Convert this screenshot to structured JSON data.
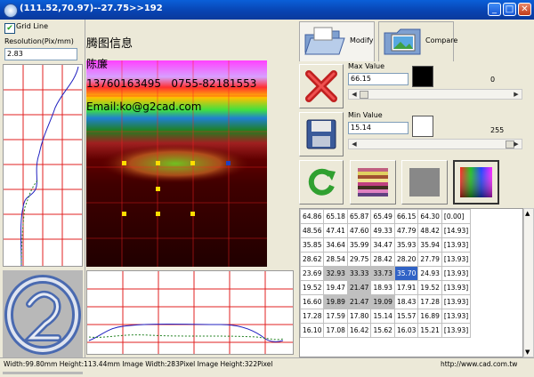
{
  "window": {
    "title": "(111.52,70.97)--27.75>>192"
  },
  "left": {
    "grid_line_label": "Grid Line",
    "grid_line_checked": true,
    "resolution_label": "Resolution(Pix/mm)",
    "resolution_value": "2.83"
  },
  "center": {
    "company": "腾图信息",
    "name": "陈廉",
    "phone": "13760163495   0755-82181553",
    "email": "Email:ko@g2cad.com"
  },
  "tabs": [
    {
      "label": "Modify"
    },
    {
      "label": "Compare"
    }
  ],
  "max": {
    "label": "Max Value",
    "value": "66.15",
    "level": "0",
    "swatch": "#000000"
  },
  "min": {
    "label": "Min Value",
    "value": "15.14",
    "level": "255",
    "swatch": "#ffffff"
  },
  "table": {
    "rows": [
      [
        "64.86",
        "65.18",
        "65.87",
        "65.49",
        "66.15",
        "64.30",
        "[0.00]"
      ],
      [
        "48.56",
        "47.41",
        "47.60",
        "49.33",
        "47.79",
        "48.42",
        "[14.93]"
      ],
      [
        "35.85",
        "34.64",
        "35.99",
        "34.47",
        "35.93",
        "35.94",
        "[13.93]"
      ],
      [
        "28.62",
        "28.54",
        "29.75",
        "28.42",
        "28.20",
        "27.79",
        "[13.93]"
      ],
      [
        "23.69",
        "32.93",
        "33.33",
        "33.73",
        "35.70",
        "24.93",
        "[13.93]"
      ],
      [
        "19.52",
        "19.47",
        "21.47",
        "18.93",
        "17.91",
        "19.52",
        "[13.93]"
      ],
      [
        "16.60",
        "19.89",
        "21.47",
        "19.09",
        "18.43",
        "17.28",
        "[13.93]"
      ],
      [
        "17.28",
        "17.59",
        "17.80",
        "15.14",
        "15.57",
        "16.89",
        "[13.93]"
      ],
      [
        "16.10",
        "17.08",
        "16.42",
        "15.62",
        "16.03",
        "15.21",
        "[13.93]"
      ]
    ]
  },
  "status": {
    "text": "Width:99.80mm  Height:113.44mm  Image Width:283Pixel  Image Height:322Pixel",
    "url": "http://www.cad.com.tw"
  },
  "colors": {
    "titlebar": "#0842b0",
    "selection": "#3163c6",
    "marker": "#ffdd00"
  }
}
